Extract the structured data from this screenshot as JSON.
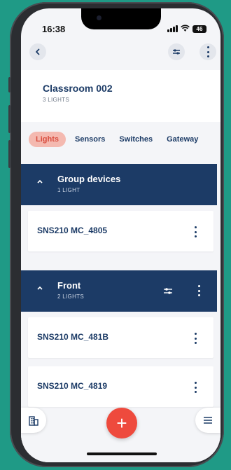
{
  "status": {
    "time": "16:38",
    "battery": "46"
  },
  "header": {
    "title": "Classroom 002",
    "subtitle": "3 LIGHTS"
  },
  "tabs": [
    {
      "label": "Lights",
      "active": true
    },
    {
      "label": "Sensors",
      "active": false
    },
    {
      "label": "Switches",
      "active": false
    },
    {
      "label": "Gateway",
      "active": false
    }
  ],
  "groups": [
    {
      "title": "Group devices",
      "subtitle": "1 LIGHT",
      "devices": [
        "SNS210 MC_4805"
      ]
    },
    {
      "title": "Front",
      "subtitle": "2 LIGHTS",
      "devices": [
        "SNS210 MC_481B",
        "SNS210 MC_4819"
      ]
    }
  ],
  "fab": {
    "label": "+"
  },
  "colors": {
    "navy": "#1c3b66",
    "accent": "#ee4a3d",
    "tab_active_bg": "#f4b9b0",
    "background": "#1f9a86"
  },
  "icons": {
    "back": "chevron-left-icon",
    "filter": "sliders-icon",
    "more": "more-vertical-icon",
    "collapse": "chevron-up-icon",
    "building": "building-icon",
    "menu": "menu-icon"
  }
}
